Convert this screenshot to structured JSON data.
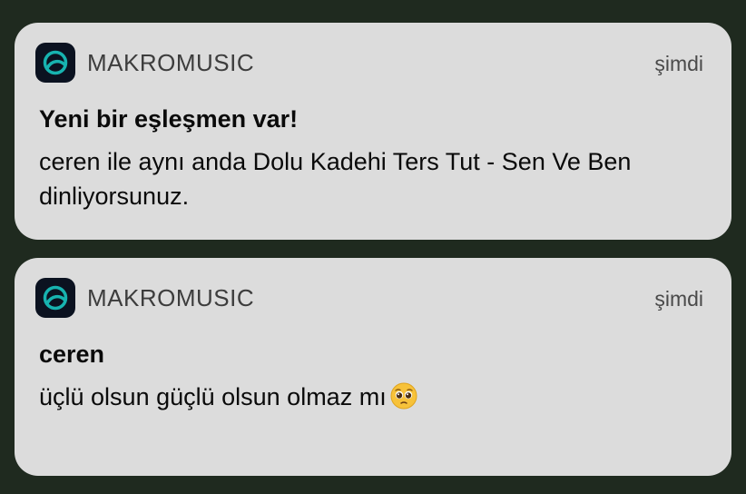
{
  "notifications": [
    {
      "app_name": "MAKROMUSIC",
      "time": "şimdi",
      "title": "Yeni bir eşleşmen var!",
      "body": "ceren ile aynı anda Dolu Kadehi Ters Tut - Sen Ve Ben dinliyorsunuz.",
      "icon": "makromusic-app-icon"
    },
    {
      "app_name": "MAKROMUSIC",
      "time": "şimdi",
      "title": "ceren",
      "body": "üçlü olsun güçlü olsun olmaz mı",
      "emoji": "pleading-face-emoji",
      "icon": "makromusic-app-icon"
    }
  ],
  "colors": {
    "background": "#1f2a1f",
    "card": "#dcdcdc",
    "app_icon_bg": "#0b1220",
    "app_icon_accent": "#17b3b0"
  }
}
